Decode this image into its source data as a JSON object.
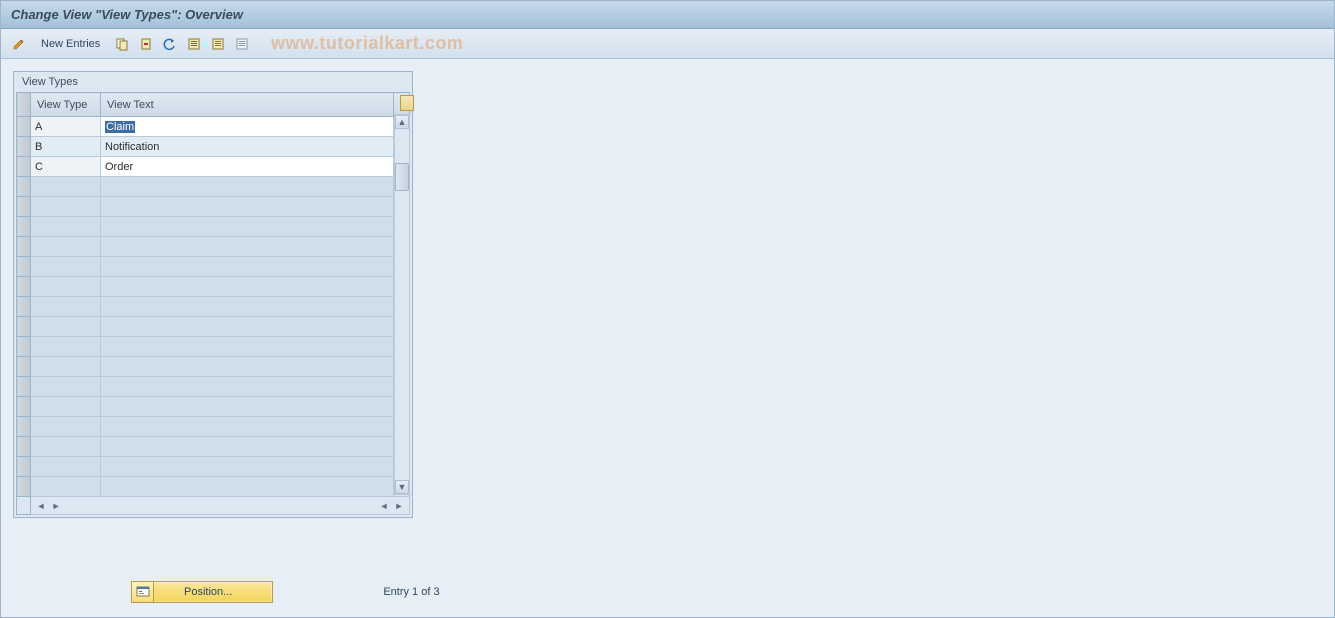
{
  "title": "Change View \"View Types\": Overview",
  "toolbar": {
    "new_entries_label": "New Entries"
  },
  "watermark": "www.tutorialkart.com",
  "panel": {
    "title": "View Types",
    "columns": {
      "type": "View Type",
      "text": "View Text"
    },
    "rows": [
      {
        "type": "A",
        "text": "Claim",
        "selected": true
      },
      {
        "type": "B",
        "text": "Notification"
      },
      {
        "type": "C",
        "text": "Order"
      }
    ],
    "empty_rows": 16
  },
  "footer": {
    "position_label": "Position...",
    "entry_info": "Entry 1 of 3"
  }
}
